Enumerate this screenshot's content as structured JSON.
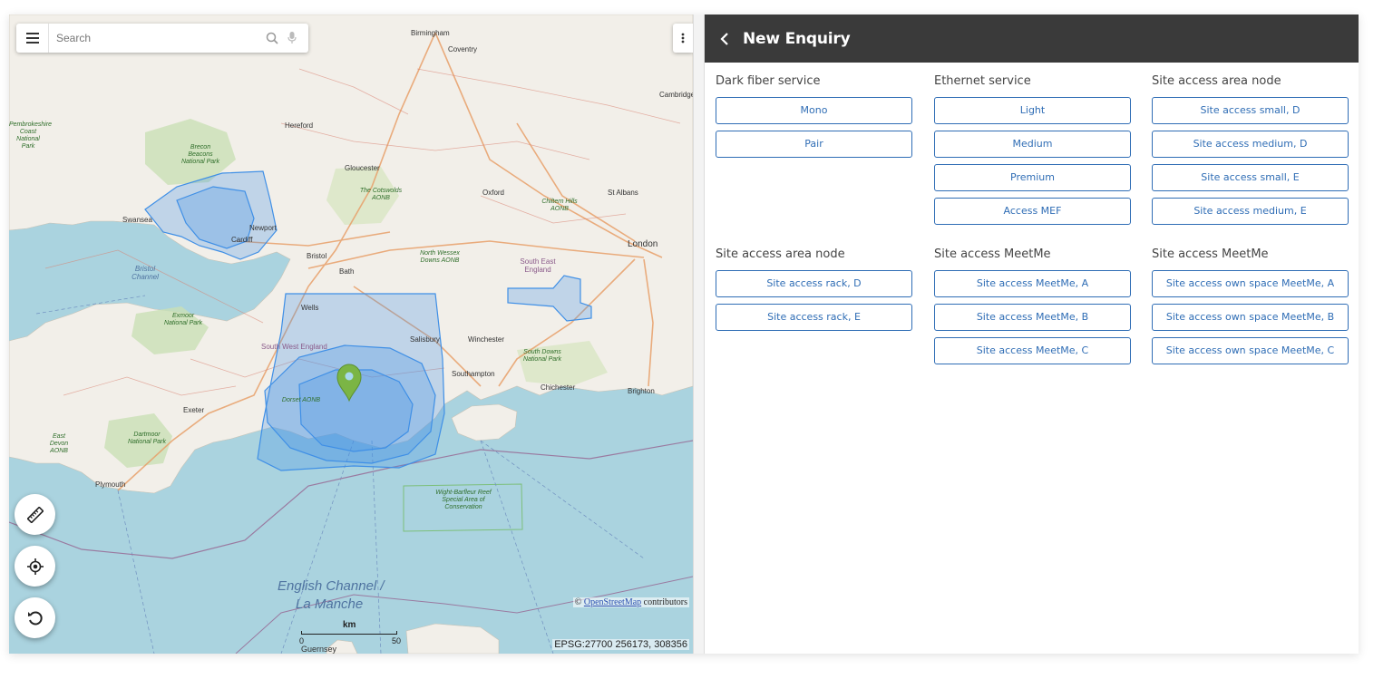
{
  "map": {
    "search_placeholder": "Search",
    "attribution_prefix": "©",
    "attribution_link": "OpenStreetMap",
    "attribution_suffix": "contributors",
    "coordinates": "EPSG:27700 256173, 308356",
    "scale": {
      "unit": "km",
      "min": "0",
      "max": "50"
    },
    "sea_labels": {
      "english_channel": "English Channel /",
      "la_manche": "La Manche",
      "bristol_channel": "Bristol Channel"
    },
    "places": {
      "birmingham": "Birmingham",
      "coventry": "Coventry",
      "hereford": "Hereford",
      "gloucester": "Gloucester",
      "oxford": "Oxford",
      "st_albans": "St Albans",
      "london": "London",
      "cambridge": "Cambridge",
      "swansea": "Swansea",
      "newport": "Newport",
      "cardiff": "Cardiff",
      "bristol": "Bristol",
      "bath": "Bath",
      "wells": "Wells",
      "salisbury": "Salisbury",
      "winchester": "Winchester",
      "southampton": "Southampton",
      "chichester": "Chichester",
      "brighton": "Brighton",
      "exeter": "Exeter",
      "plymouth": "Plymouth",
      "guernsey": "Guernsey",
      "south_west_england": "South West England",
      "south_east_england": "South East England"
    },
    "parks": {
      "brecon": "Brecon Beacons National Park",
      "cotswolds": "The Cotswolds AONB",
      "exmoor": "Exmoor National Park",
      "dartmoor": "Dartmoor National Park",
      "south_downs": "South Downs National Park",
      "north_wessex": "North Wessex Downs AONB",
      "chiltern": "Chiltern Hills AONB",
      "pembrokeshire": "Pembrokeshire Coast National Park",
      "dorset": "Dorset AONB",
      "wight_barfleur": "Wight-Barfleur Reef Special Area of Conservation",
      "east_devon": "East Devon AONB"
    },
    "colors": {
      "sea": "#aad3df",
      "land": "#f2efe9",
      "coverage": "#3f8fe6",
      "marker": "#7bb545"
    },
    "controls": [
      "measure-icon",
      "locate-icon",
      "refresh-icon"
    ]
  },
  "panel": {
    "title": "New Enquiry",
    "groups": [
      {
        "heading": "Dark fiber service",
        "buttons": [
          "Mono",
          "Pair"
        ]
      },
      {
        "heading": "Ethernet service",
        "buttons": [
          "Light",
          "Medium",
          "Premium",
          "Access MEF"
        ]
      },
      {
        "heading": "Site access area node",
        "buttons": [
          "Site access small, D",
          "Site access medium, D",
          "Site access small, E",
          "Site access medium, E"
        ]
      },
      {
        "heading": "Site access area node",
        "buttons": [
          "Site access rack, D",
          "Site access rack, E"
        ]
      },
      {
        "heading": "Site access MeetMe",
        "buttons": [
          "Site access MeetMe, A",
          "Site access MeetMe, B",
          "Site access MeetMe, C"
        ]
      },
      {
        "heading": "Site access MeetMe",
        "buttons": [
          "Site access own space MeetMe, A",
          "Site access own space MeetMe, B",
          "Site access own space MeetMe, C"
        ]
      }
    ],
    "colors": {
      "header_bg": "#3a3a3a",
      "button_border": "#2f6db5"
    }
  }
}
